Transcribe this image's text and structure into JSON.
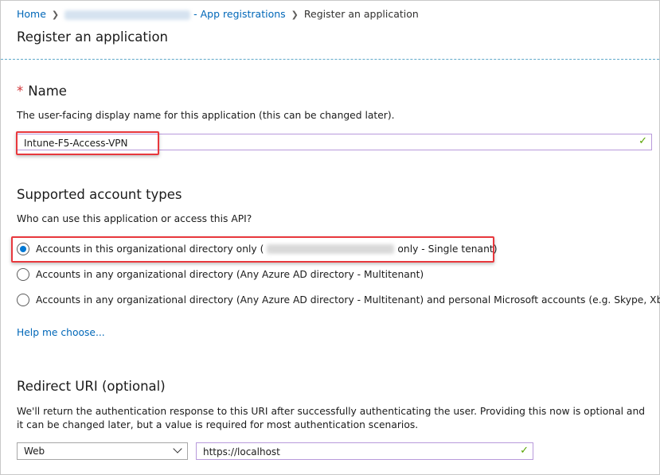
{
  "breadcrumb": {
    "home": "Home",
    "app_registrations": "- App registrations",
    "current": "Register an application"
  },
  "page_title": "Register an application",
  "name_section": {
    "required_mark": "*",
    "title": "Name",
    "description": "The user-facing display name for this application (this can be changed later).",
    "value": "Intune-F5-Access-VPN"
  },
  "account_types": {
    "title": "Supported account types",
    "question": "Who can use this application or access this API?",
    "options": [
      {
        "label_start": "Accounts in this organizational directory only (",
        "label_end": "only - Single tenant)",
        "selected": true
      },
      {
        "label": "Accounts in any organizational directory (Any Azure AD directory - Multitenant)",
        "selected": false
      },
      {
        "label": "Accounts in any organizational directory (Any Azure AD directory - Multitenant) and personal Microsoft accounts (e.g. Skype, Xbox)",
        "selected": false
      }
    ],
    "help_link": "Help me choose..."
  },
  "redirect": {
    "title": "Redirect URI (optional)",
    "description": "We'll return the authentication response to this URI after successfully authenticating the user. Providing this now is optional and it can be changed later, but a value is required for most authentication scenarios.",
    "platform": "Web",
    "uri": "https://localhost"
  },
  "colors": {
    "link": "#0067b8",
    "highlight_box": "#e8383d",
    "valid_check": "#57a300",
    "radio_selected": "#0078d4"
  }
}
